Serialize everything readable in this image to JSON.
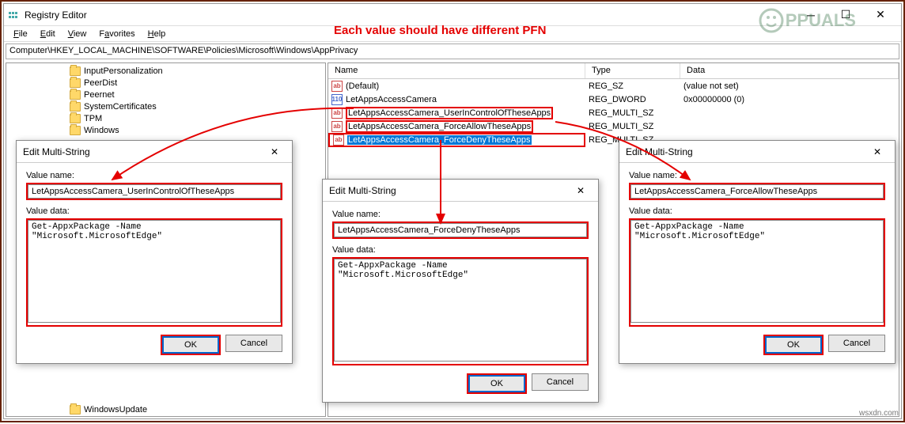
{
  "window": {
    "title": "Registry Editor"
  },
  "menu": {
    "file": "File",
    "edit": "Edit",
    "view": "View",
    "favorites": "Favorites",
    "help": "Help"
  },
  "address": "Computer\\HKEY_LOCAL_MACHINE\\SOFTWARE\\Policies\\Microsoft\\Windows\\AppPrivacy",
  "tree": {
    "items": [
      "InputPersonalization",
      "PeerDist",
      "Peernet",
      "SystemCertificates",
      "TPM",
      "Windows"
    ],
    "bottom_item": "WindowsUpdate"
  },
  "list": {
    "columns": {
      "name": "Name",
      "type": "Type",
      "data": "Data"
    },
    "rows": [
      {
        "icon": "sz",
        "name": "(Default)",
        "type": "REG_SZ",
        "data": "(value not set)"
      },
      {
        "icon": "dw",
        "name": "LetAppsAccessCamera",
        "type": "REG_DWORD",
        "data": "0x00000000 (0)"
      },
      {
        "icon": "msz",
        "name": "LetAppsAccessCamera_UserInControlOfTheseApps",
        "type": "REG_MULTI_SZ",
        "data": ""
      },
      {
        "icon": "msz",
        "name": "LetAppsAccessCamera_ForceAllowTheseApps",
        "type": "REG_MULTI_SZ",
        "data": ""
      },
      {
        "icon": "msz",
        "name": "LetAppsAccessCamera_ForceDenyTheseApps",
        "type": "REG_MULTI_SZ",
        "data": ""
      }
    ]
  },
  "dialogs": {
    "title": "Edit Multi-String",
    "value_name_label": "Value name:",
    "value_data_label": "Value data:",
    "ok": "OK",
    "cancel": "Cancel",
    "d1": {
      "value_name": "LetAppsAccessCamera_UserInControlOfTheseApps",
      "value_data": "Get-AppxPackage -Name \"Microsoft.MicrosoftEdge\""
    },
    "d2": {
      "value_name": "LetAppsAccessCamera_ForceDenyTheseApps",
      "value_data": "Get-AppxPackage -Name \"Microsoft.MicrosoftEdge\""
    },
    "d3": {
      "value_name": "LetAppsAccessCamera_ForceAllowTheseApps",
      "value_data": "Get-AppxPackage -Name \"Microsoft.MicrosoftEdge\""
    }
  },
  "annotation": "Each value should have different PFN",
  "logo_text": "PPUALS",
  "watermark": "wsxdn.com"
}
